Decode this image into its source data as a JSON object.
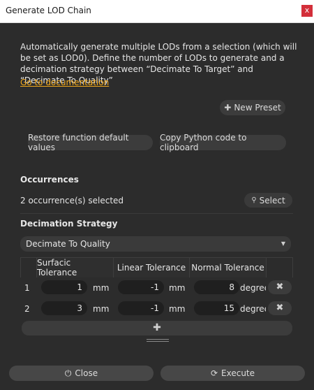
{
  "window": {
    "title": "Generate LOD Chain",
    "close_glyph": "x"
  },
  "description": "Automatically generate multiple LODs from a selection (which will be set as LOD0). Define the number of LODs to generate and a decimation strategy between “Decimate To Target” and “Decimate To Quality”",
  "doc_link": "Go to documentation",
  "toolbar": {
    "new_preset": "New Preset",
    "restore_defaults": "Restore function default values",
    "copy_python": "Copy Python code to clipboard"
  },
  "occurrences": {
    "title": "Occurrences",
    "status": "2 occurrence(s) selected",
    "select_label": "Select"
  },
  "decimation": {
    "title": "Decimation Strategy",
    "selected": "Decimate To Quality"
  },
  "table": {
    "headers": [
      "Surfacic Tolerance",
      "Linear Tolerance",
      "Normal Tolerance"
    ],
    "rows": [
      {
        "index": "1",
        "surfacic": "1",
        "surfacic_unit": "mm",
        "linear": "-1",
        "linear_unit": "mm",
        "normal": "8",
        "normal_unit": "degrees"
      },
      {
        "index": "2",
        "surfacic": "3",
        "surfacic_unit": "mm",
        "linear": "-1",
        "linear_unit": "mm",
        "normal": "15",
        "normal_unit": "degrees"
      }
    ]
  },
  "footer": {
    "close_label": "Close",
    "execute_label": "Execute"
  },
  "colors": {
    "background": "#2c2c2c",
    "accent_link": "#f0a81c",
    "close_button": "#d32f3a"
  }
}
